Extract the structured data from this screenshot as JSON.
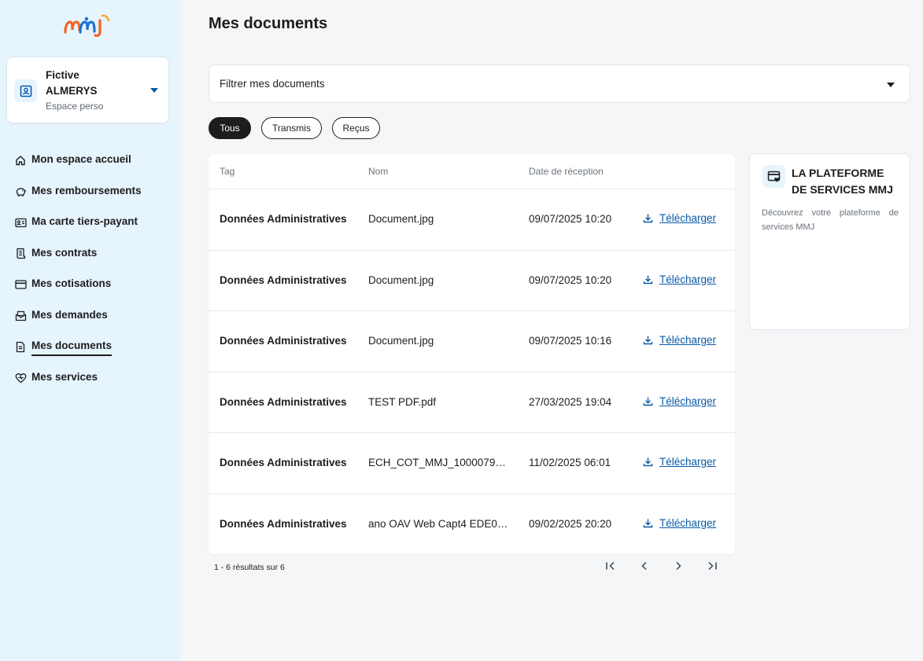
{
  "colors": {
    "sidebar_bg": "#e6f4fd",
    "accent": "#0a5aa6",
    "logo_orange": "#f26522",
    "logo_blue": "#1a75cf"
  },
  "profile": {
    "first_name": "Fictive",
    "last_name": "ALMERYS",
    "subtitle": "Espace perso",
    "icon": "user-card-icon"
  },
  "nav": [
    {
      "label": "Mon espace accueil",
      "icon": "home-icon"
    },
    {
      "label": "Mes remboursements",
      "icon": "piggy-bank-icon"
    },
    {
      "label": "Ma carte tiers-payant",
      "icon": "id-card-icon"
    },
    {
      "label": "Mes contrats",
      "icon": "contract-icon"
    },
    {
      "label": "Mes cotisations",
      "icon": "credit-card-icon"
    },
    {
      "label": "Mes demandes",
      "icon": "mail-icon"
    },
    {
      "label": "Mes documents",
      "icon": "document-icon",
      "active": true
    },
    {
      "label": "Mes services",
      "icon": "heart-hand-icon"
    }
  ],
  "page": {
    "title": "Mes documents"
  },
  "filter": {
    "label": "Filtrer mes documents"
  },
  "chips": [
    {
      "label": "Tous",
      "active": true
    },
    {
      "label": "Transmis",
      "active": false
    },
    {
      "label": "Reçus",
      "active": false
    }
  ],
  "table": {
    "headers": {
      "tag": "Tag",
      "name": "Nom",
      "date": "Date de réception"
    },
    "rows": [
      {
        "tag": "Données Administratives",
        "name": "Document.jpg",
        "date": "09/07/2025 10:20",
        "action": "Télécharger"
      },
      {
        "tag": "Données Administratives",
        "name": "Document.jpg",
        "date": "09/07/2025 10:20",
        "action": "Télécharger"
      },
      {
        "tag": "Données Administratives",
        "name": "Document.jpg",
        "date": "09/07/2025 10:16",
        "action": "Télécharger"
      },
      {
        "tag": "Données Administratives",
        "name": "TEST PDF.pdf",
        "date": "27/03/2025 19:04",
        "action": "Télécharger"
      },
      {
        "tag": "Données Administratives",
        "name": "ECH_COT_MMJ_10000790…",
        "date": "11/02/2025 06:01",
        "action": "Télécharger"
      },
      {
        "tag": "Données Administratives",
        "name": "ano OAV Web Capt4 EDE07…",
        "date": "09/02/2025 20:20",
        "action": "Télécharger"
      }
    ]
  },
  "pagination": {
    "summary": "1 - 6 résultats sur 6",
    "icons": [
      "first-page-icon",
      "prev-page-icon",
      "next-page-icon",
      "last-page-icon"
    ]
  },
  "promo": {
    "title": "LA PLATEFORME DE SERVICES MMJ",
    "text": "Découvrez votre plateforme de services MMJ",
    "icon": "services-card-icon"
  }
}
